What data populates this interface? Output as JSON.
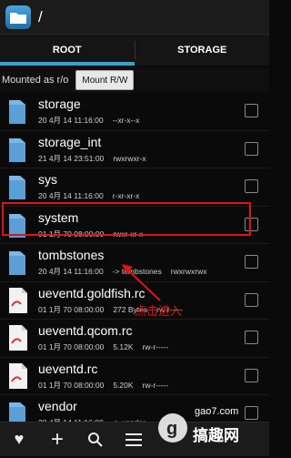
{
  "header": {
    "path": "/"
  },
  "tabs": [
    {
      "label": "ROOT",
      "active": true
    },
    {
      "label": "STORAGE",
      "active": false
    }
  ],
  "mount": {
    "status": "Mounted as r/o",
    "button": "Mount R/W"
  },
  "files": [
    {
      "name": "storage",
      "date": "20 4月 14 11:16:00",
      "extra": "",
      "perm": "--xr-x--x",
      "type": "folder"
    },
    {
      "name": "storage_int",
      "date": "21 4月 14 23:51:00",
      "extra": "",
      "perm": "rwxrwxr-x",
      "type": "folder"
    },
    {
      "name": "sys",
      "date": "20 4月 14 11:16:00",
      "extra": "",
      "perm": "r-xr-xr-x",
      "type": "folder"
    },
    {
      "name": "system",
      "date": "01 1月 70 08:00:00",
      "extra": "",
      "perm": "rwxr-xr-x",
      "type": "folder"
    },
    {
      "name": "tombstones",
      "date": "20 4月 14 11:16:00",
      "extra": "-> tombstones",
      "perm": "rwxrwxrwx",
      "type": "folder"
    },
    {
      "name": "ueventd.goldfish.rc",
      "date": "01 1月 70 08:00:00",
      "extra": "272 Bytes",
      "perm": "rw-r-----",
      "type": "file"
    },
    {
      "name": "ueventd.qcom.rc",
      "date": "01 1月 70 08:00:00",
      "extra": "5.12K",
      "perm": "rw-r-----",
      "type": "file"
    },
    {
      "name": "ueventd.rc",
      "date": "01 1月 70 08:00:00",
      "extra": "5.20K",
      "perm": "rw-r-----",
      "type": "file"
    },
    {
      "name": "vendor",
      "date": "20 4月 14 11:16:00",
      "extra": "-> vendor",
      "perm": "",
      "type": "folder"
    }
  ],
  "annotation": {
    "text": "点击进入"
  },
  "toolbar": {
    "icons": [
      "heart-icon",
      "add-icon",
      "search-icon",
      "menu-icon"
    ]
  },
  "watermark": {
    "site": "gao7.com",
    "brand": "搞趣网"
  },
  "colors": {
    "accent": "#33a4d6",
    "highlight": "#e01414",
    "folder": "#5b9fd6"
  }
}
